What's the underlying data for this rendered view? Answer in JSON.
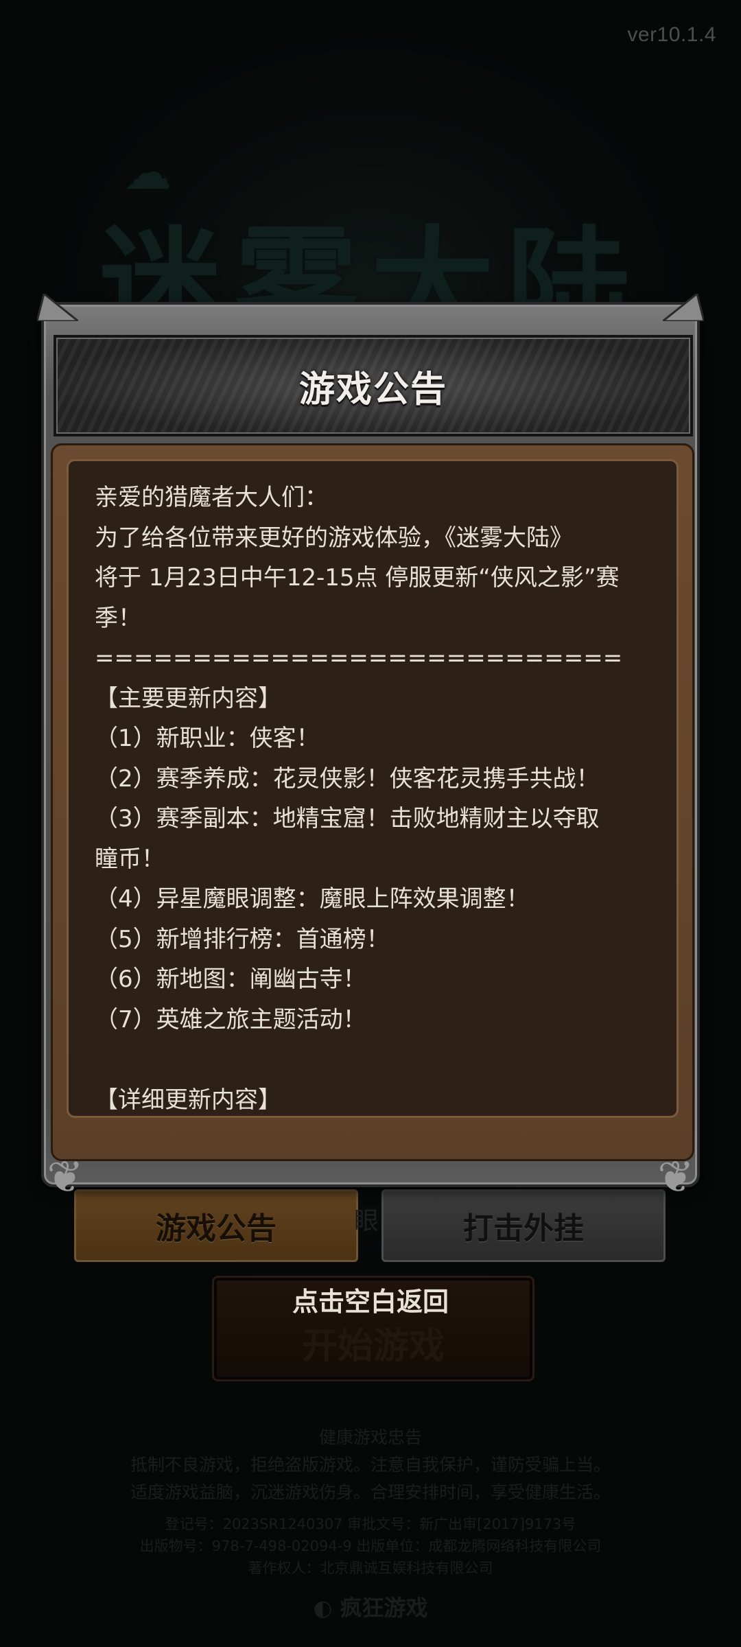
{
  "version": "ver10.1.4",
  "logo_text": "迷雾大陆",
  "modal": {
    "title": "游戏公告",
    "lines": [
      "亲爱的猎魔者大人们：",
      "为了给各位带来更好的游戏体验，《迷雾大陆》",
      "将于 1月23日中午12-15点 停服更新“侠风之影”赛",
      "季！",
      "===========================",
      "【主要更新内容】",
      "（1）新职业：侠客！",
      "（2）赛季养成：花灵侠影！侠客花灵携手共战！",
      "（3）赛季副本：地精宝窟！击败地精财主以夺取",
      "瞳币！",
      "（4）异星魔眼调整：魔眼上阵效果调整！",
      "（5）新增排行榜：首通榜！",
      "（6）新地图：阐幽古寺！",
      "（7）英雄之旅主题活动！",
      "",
      "【详细更新内容】"
    ]
  },
  "buttons": {
    "notice": "游戏公告",
    "anti_cheat": "打击外挂",
    "start": "开始游戏",
    "partial_label": "眼"
  },
  "tap_hint": "点击空白返回",
  "footer": {
    "heading": "健康游戏忠告",
    "advice_1": "抵制不良游戏，拒绝盗版游戏。注意自我保护，谨防受骗上当。",
    "advice_2": "适度游戏益脑，沉迷游戏伤身。合理安排时间，享受健康生活。",
    "reg_line": "登记号：2023SR1240307    审批文号：新广出审[2017]9173号",
    "isbn_line": "出版物号：978-7-498-02094-9    出版单位：成都龙腾网络科技有限公司",
    "copyright_line": "著作权人：北京鼎诚互娱科技有限公司",
    "brand": "疯狂游戏"
  }
}
